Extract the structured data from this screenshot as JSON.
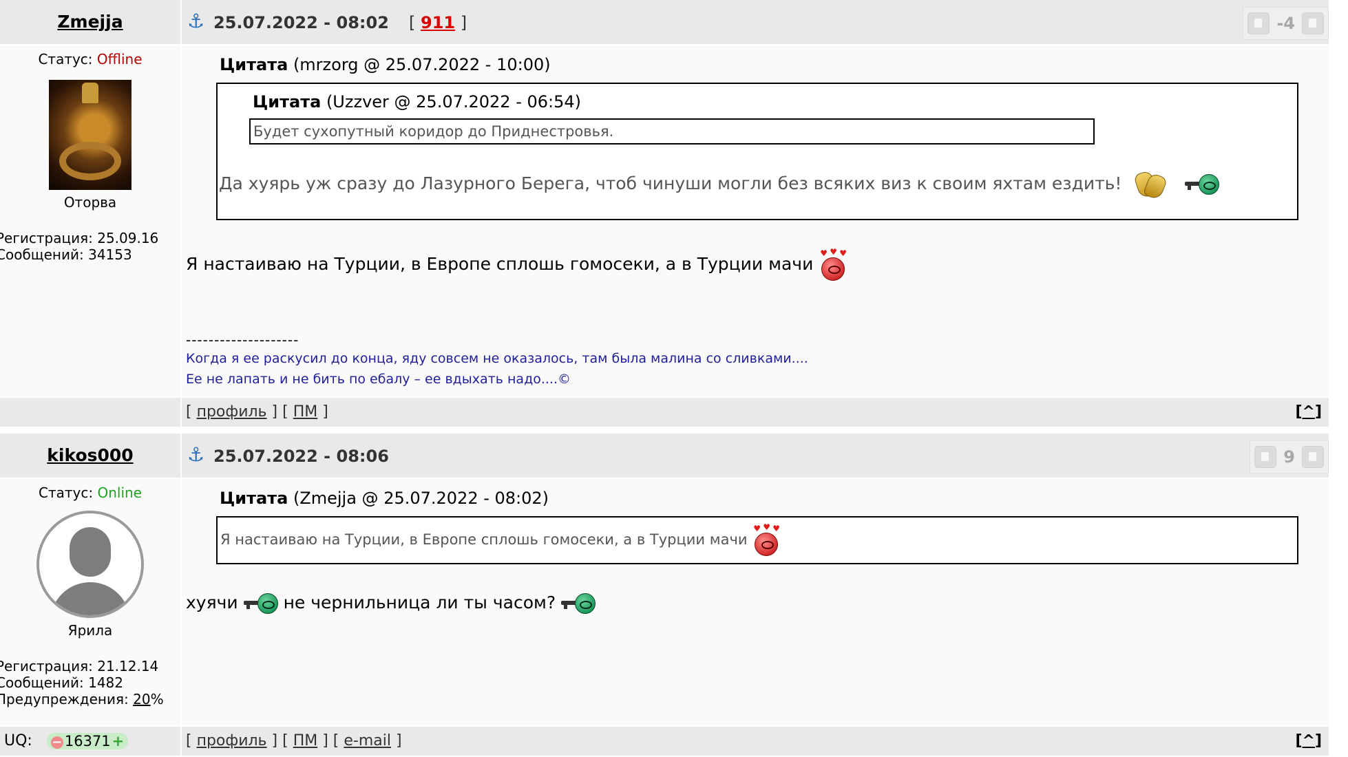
{
  "posts": [
    {
      "author": {
        "name": "Zmejja",
        "status_label": "Статус:",
        "status_value": "Offline",
        "rank": "Оторва",
        "reg_label": "Регистрация:",
        "reg_value": "25.09.16",
        "msgs_label": "Сообщений:",
        "msgs_value": "34153"
      },
      "date": "25.07.2022 - 08:02",
      "post_number": "911",
      "rating": "-4",
      "quote_outer": {
        "label": "Цитата",
        "meta": "(mrzorg @ 25.07.2022 - 10:00)",
        "inner": {
          "label": "Цитата",
          "meta": "(Uzzver @ 25.07.2022 - 06:54)",
          "text": "Будет сухопутный коридор до Приднестровья."
        },
        "text": "Да хуярь уж сразу до Лазурного Берега, чтоб чинуши могли без всяких виз к своим яхтам ездить!"
      },
      "message": "Я настаиваю на Турции, в Европе сплошь гомосеки, а в Турции мачи",
      "signature": {
        "separator": "--------------------",
        "line1": "Когда я ее раскусил до конца, яду совсем не оказалось, там была малина со сливками....",
        "line2": "Ее не лапать и не бить по ебалу – ее вдыхать надо....©"
      },
      "footer": {
        "profile": "профиль",
        "pm": "ПМ",
        "top": "^"
      }
    },
    {
      "author": {
        "name": "kikos000",
        "status_label": "Статус:",
        "status_value": "Online",
        "rank": "Ярила",
        "reg_label": "Регистрация:",
        "reg_value": "21.12.14",
        "msgs_label": "Сообщений:",
        "msgs_value": "1482",
        "warn_label": "Предупреждения:",
        "warn_value": "20",
        "warn_suffix": "%",
        "uq_label": "UQ:",
        "uq_value": "16371"
      },
      "date": "25.07.2022 - 08:06",
      "rating": "9",
      "quote": {
        "label": "Цитата",
        "meta": "(Zmejja @ 25.07.2022 - 08:02)",
        "text": "Я настаиваю на Турции, в Европе сплошь гомосеки, а в Турции мачи"
      },
      "message_part1": "хуячи",
      "message_part2": "не чернильница ли ты часом?",
      "footer": {
        "profile": "профиль",
        "pm": "ПМ",
        "email": "e-mail",
        "top": "^"
      }
    }
  ],
  "icons": {
    "anchor": "anchor-icon",
    "thumb_down": "thumb-down-icon",
    "thumb_up": "thumb-up-icon",
    "smile_love": "in-love-smiley-icon",
    "smile_gun": "gun-smiley-icon",
    "smile_clap": "clapping-hands-icon"
  },
  "colors": {
    "offline": "#b40000",
    "online": "#1fa31f",
    "post_number": "#d90000",
    "signature": "#20209a",
    "header_bg": "#e9e9e9"
  }
}
